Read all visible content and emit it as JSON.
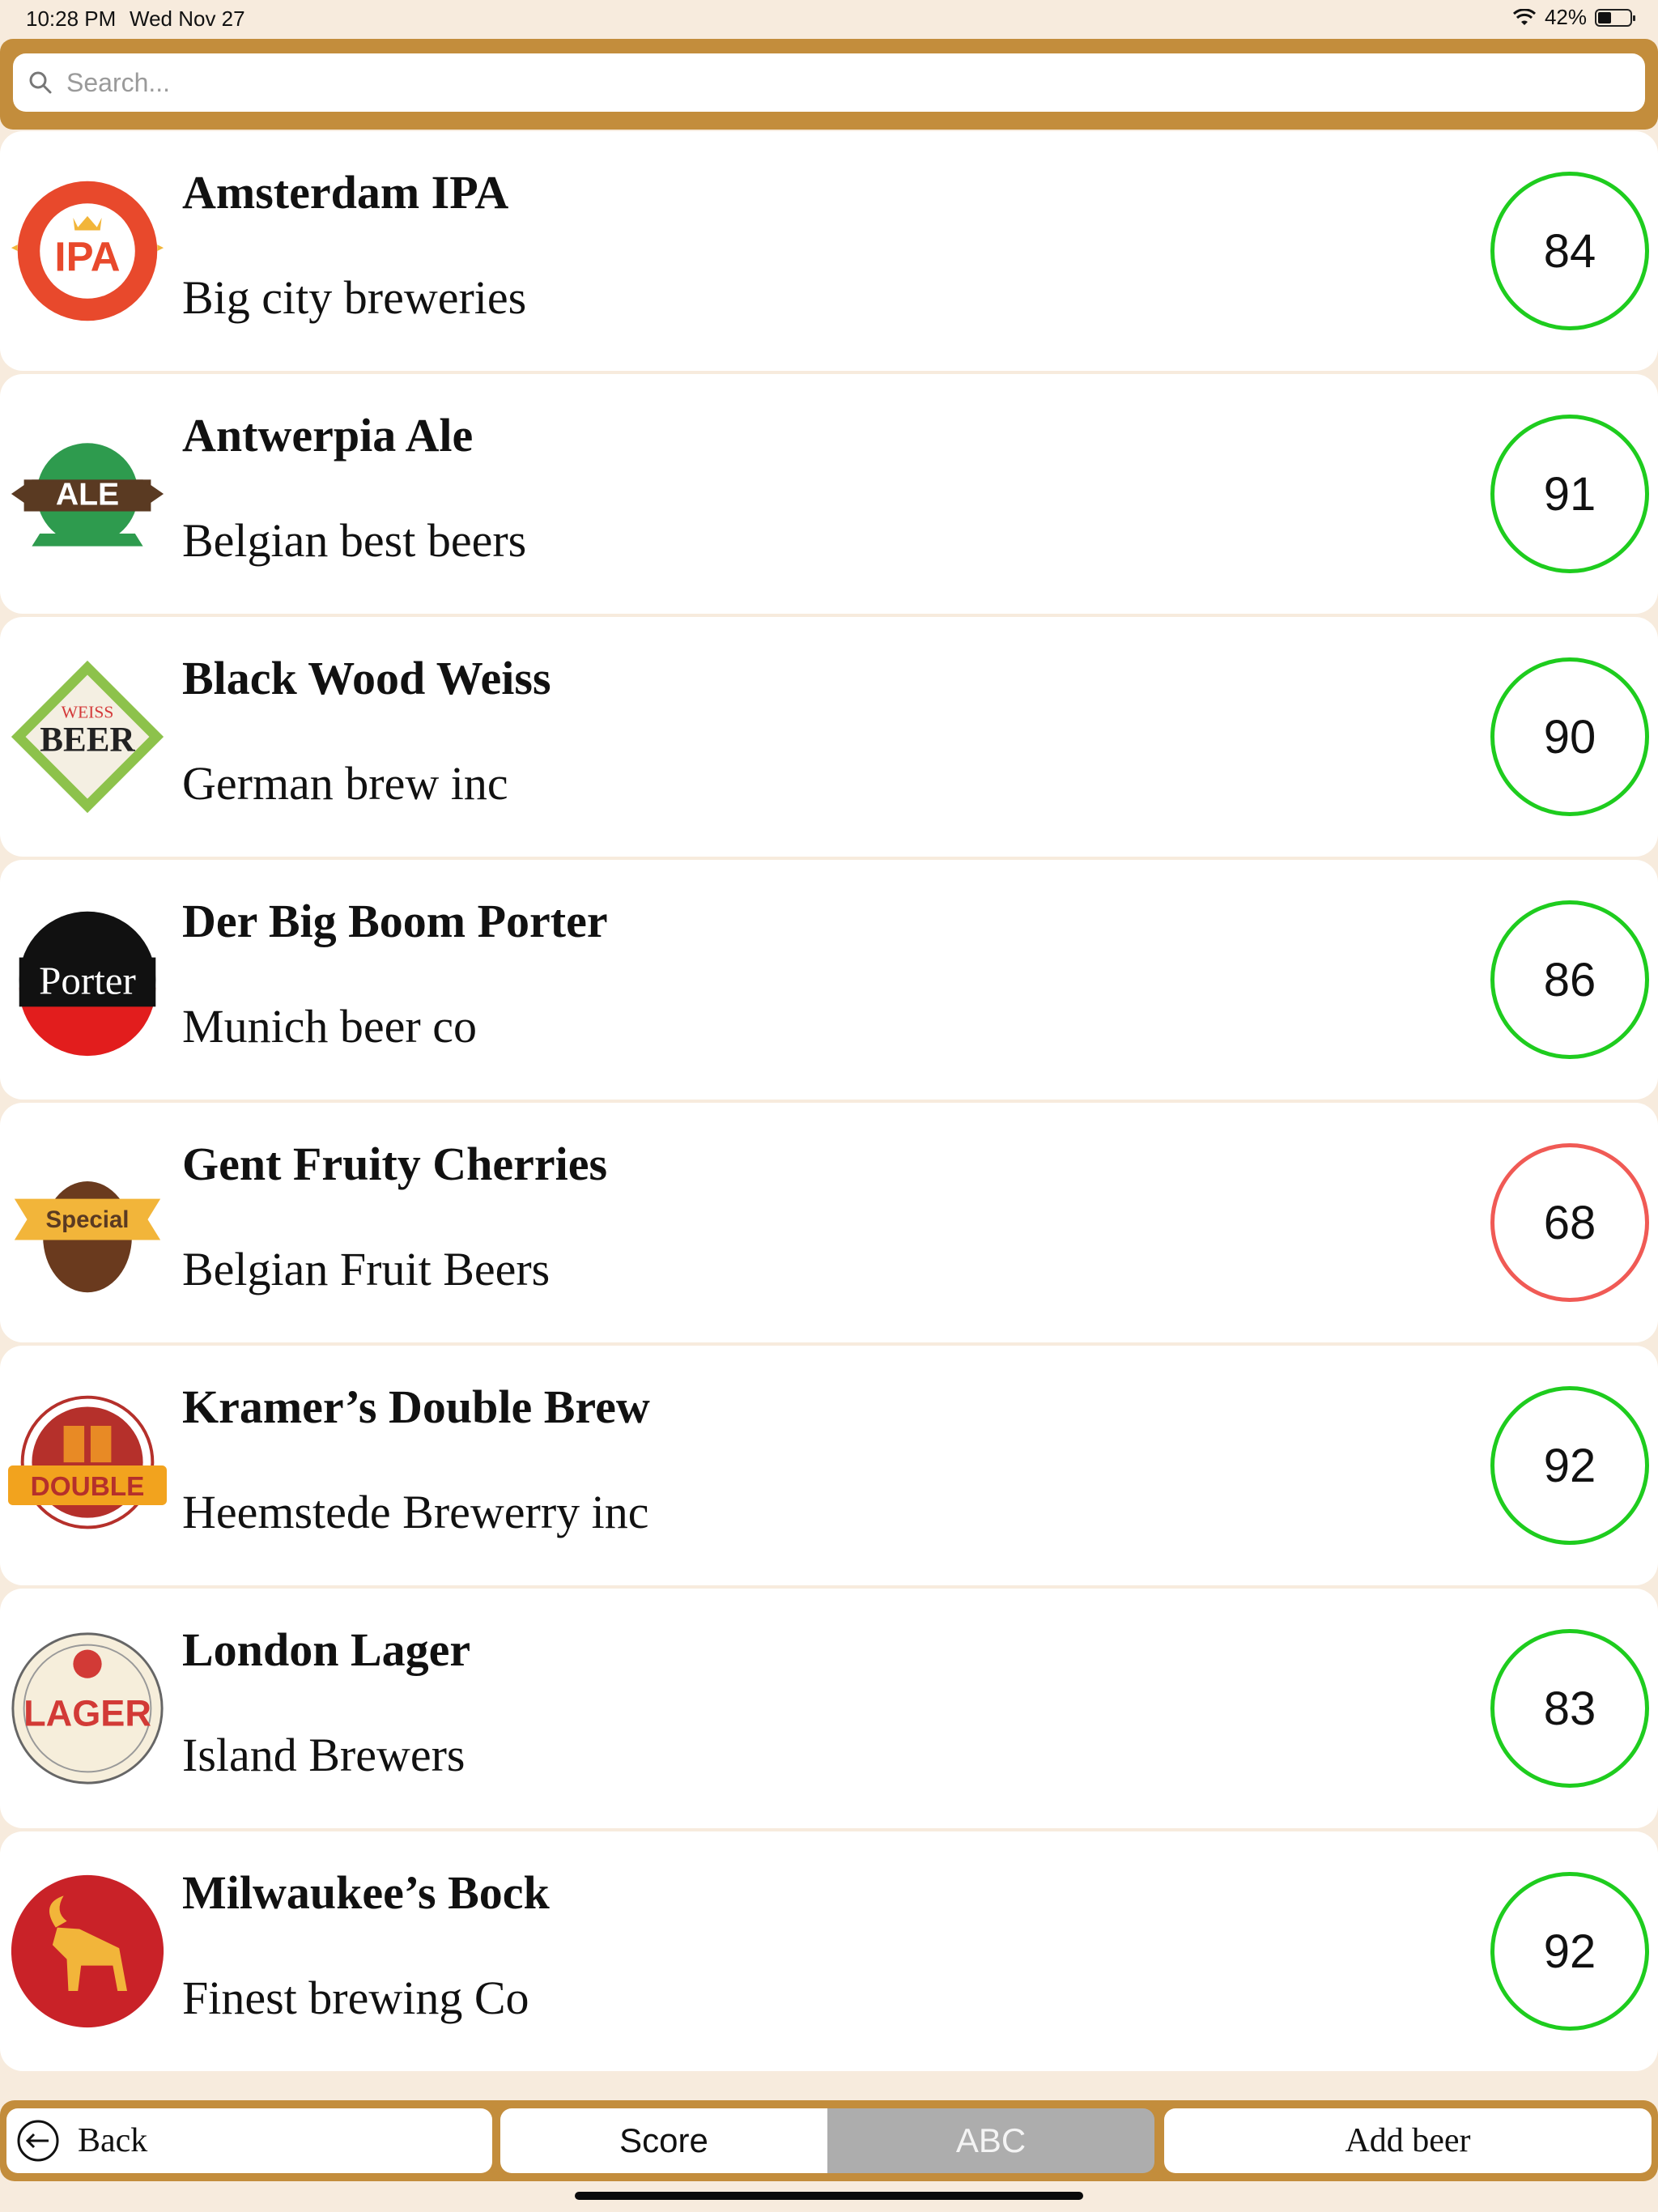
{
  "status_bar": {
    "time": "10:28 PM",
    "date": "Wed Nov 27",
    "battery": "42%",
    "battery_level": 0.42
  },
  "search": {
    "placeholder": "Search..."
  },
  "beers": [
    {
      "name": "Amsterdam IPA",
      "brewery": "Big city breweries",
      "score": "84",
      "logo": "ipa-badge-icon",
      "logo_text": "IPA"
    },
    {
      "name": "Antwerpia Ale",
      "brewery": "Belgian best beers",
      "score": "91",
      "logo": "ale-badge-icon",
      "logo_text": "ALE"
    },
    {
      "name": "Black Wood Weiss",
      "brewery": "German brew inc",
      "score": "90",
      "logo": "weiss-beer-badge-icon",
      "logo_text": "BEER"
    },
    {
      "name": "Der Big Boom Porter",
      "brewery": "Munich beer co",
      "score": "86",
      "logo": "porter-badge-icon",
      "logo_text": "Porter"
    },
    {
      "name": "Gent Fruity Cherries",
      "brewery": "Belgian Fruit Beers",
      "score": "68",
      "logo": "special-barrel-badge-icon",
      "logo_text": "Special"
    },
    {
      "name": "Kramer’s Double Brew",
      "brewery": "Heemstede Brewerry inc",
      "score": "92",
      "logo": "double-badge-icon",
      "logo_text": "DOUBLE"
    },
    {
      "name": "London Lager",
      "brewery": "Island Brewers",
      "score": "83",
      "logo": "lager-badge-icon",
      "logo_text": "LAGER"
    },
    {
      "name": "Milwaukee’s Bock",
      "brewery": "Finest brewing Co",
      "score": "92",
      "logo": "goat-badge-icon",
      "logo_text": ""
    }
  ],
  "toolbar": {
    "back_label": "Back",
    "score_label": "Score",
    "abc_label": "ABC",
    "add_label": "Add beer",
    "selected_sort": "ABC"
  },
  "colors": {
    "accent": "#c38d3c",
    "background": "#f7ebdd",
    "score_good": "#1ecc1e",
    "score_low": "#f05a55",
    "segment_selected": "#adadad"
  }
}
